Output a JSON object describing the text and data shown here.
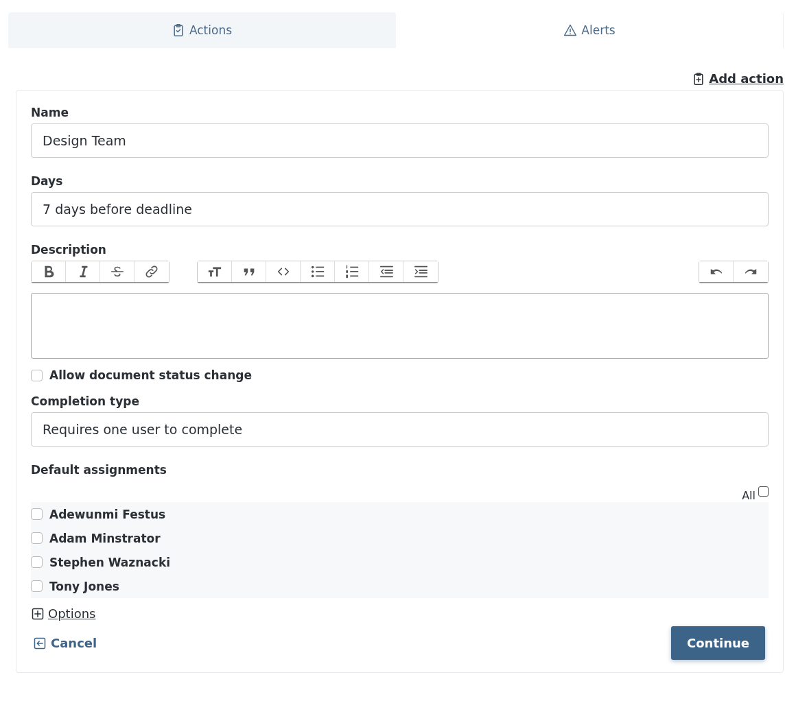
{
  "tabs": [
    {
      "label": "Actions",
      "selected": true
    },
    {
      "label": "Alerts",
      "selected": false
    }
  ],
  "add_action": "Add action",
  "form": {
    "fields": [
      {
        "label": "Name",
        "value": "Design Team"
      },
      {
        "label": "Days",
        "value": "7 days before deadline"
      }
    ],
    "description": {
      "label": "Description",
      "toolbar": [
        [
          {
            "kind": "bold"
          },
          {
            "kind": "italic"
          },
          {
            "kind": "strike"
          },
          {
            "kind": "link"
          }
        ],
        [
          {
            "kind": "heading"
          },
          {
            "kind": "quote"
          },
          {
            "kind": "code"
          },
          {
            "kind": "bullets"
          },
          {
            "kind": "numbers"
          },
          {
            "kind": "outdent"
          },
          {
            "kind": "indent"
          }
        ],
        [
          {
            "kind": "undo"
          },
          {
            "kind": "redo"
          }
        ]
      ]
    },
    "allow_status_change": {
      "label": "Allow document status change",
      "checked": false
    },
    "completion_type": {
      "label": "Completion type",
      "value": "Requires one user to complete"
    },
    "assignments": {
      "label": "Default assignments",
      "all_label": "All",
      "all_checked": false,
      "users": [
        {
          "name": "Adewunmi Festus",
          "checked": false
        },
        {
          "name": "Adam Minstrator",
          "checked": false
        },
        {
          "name": "Stephen Waznacki",
          "checked": false
        },
        {
          "name": "Tony Jones",
          "checked": false
        }
      ]
    },
    "options": "Options",
    "cancel": "Cancel",
    "continue": "Continue"
  }
}
